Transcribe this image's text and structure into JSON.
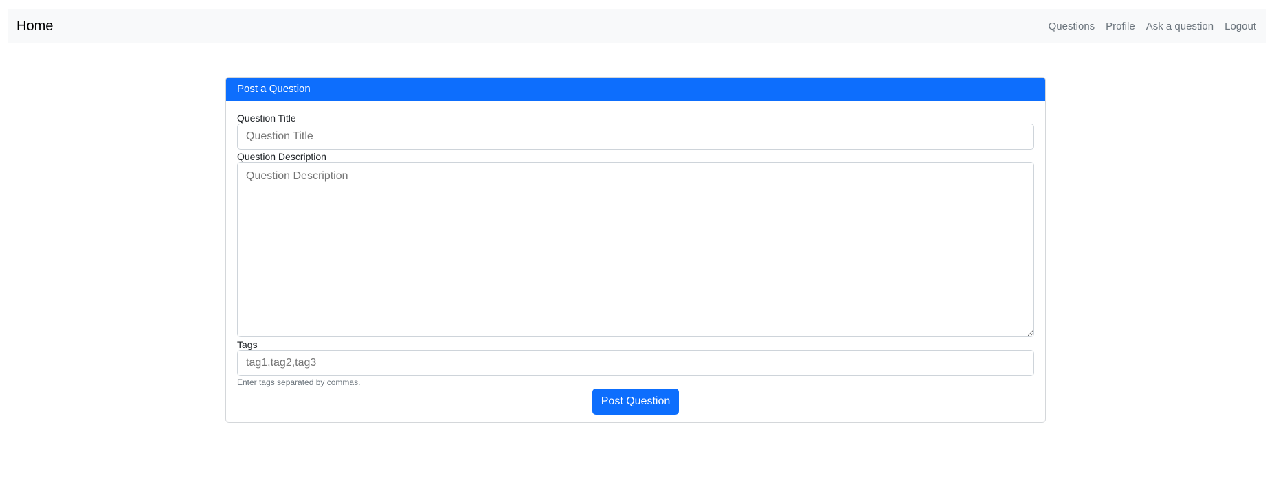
{
  "navbar": {
    "brand": "Home",
    "links": [
      {
        "label": "Questions"
      },
      {
        "label": "Profile"
      },
      {
        "label": "Ask a question"
      },
      {
        "label": "Logout"
      }
    ]
  },
  "card": {
    "header": "Post a Question",
    "form": {
      "title_label": "Question Title",
      "title_placeholder": "Question Title",
      "description_label": "Question Description",
      "description_placeholder": "Question Description",
      "tags_label": "Tags",
      "tags_placeholder": "tag1,tag2,tag3",
      "tags_help": "Enter tags separated by commas.",
      "submit_label": "Post Question"
    }
  },
  "colors": {
    "primary": "#0d6efd",
    "navbar_bg": "#f8f9fa",
    "muted": "#6c757d"
  }
}
